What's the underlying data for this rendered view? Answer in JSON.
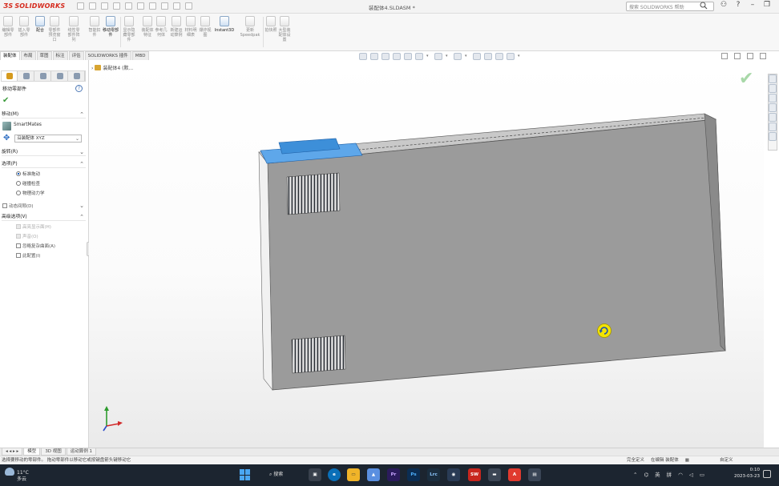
{
  "app": {
    "name": "SOLIDWORKS",
    "doc_title": "装配体4.SLDASM *"
  },
  "search": {
    "placeholder": "搜索 SOLIDWORKS 帮助"
  },
  "tabs": [
    "装配体",
    "布局",
    "草图",
    "标注",
    "评估",
    "SOLIDWORKS 插件",
    "MBD"
  ],
  "ribbon": {
    "items": [
      "编辑零部件",
      "插入零部件",
      "配合",
      "零部件预览窗口",
      "线性零部件阵列",
      "智能扣件",
      "移动零部件",
      "显示隐藏零部件",
      "装配体特征",
      "参考几何体",
      "新建运动算例",
      "材料明细表",
      "爆炸视图",
      "Instant3D",
      "更新Speedpak",
      "拍快照",
      "大型装配体设置"
    ],
    "active": "移动零部件"
  },
  "panel": {
    "title": "移动零部件",
    "move_section": "移动(M)",
    "smartmates": "SmartMates",
    "move_mode": "沿装配体 XYZ",
    "rotate_section": "旋转(R)",
    "options_section": "选项(P)",
    "options": [
      {
        "label": "标准拖动",
        "checked": true
      },
      {
        "label": "碰撞检查",
        "checked": false
      },
      {
        "label": "物理动力学",
        "checked": false
      }
    ],
    "dynamic_clearance": "动态间隙(D)",
    "advanced_section": "高级选项(V)",
    "advanced": [
      {
        "label": "高亮显示面(H)",
        "disabled": true
      },
      {
        "label": "声音(O)",
        "disabled": true
      },
      {
        "label": "忽略复杂曲面(A)",
        "disabled": false
      },
      {
        "label": "此配置(I)",
        "disabled": false
      }
    ]
  },
  "tree": {
    "root": "装配体4 (默..."
  },
  "bottom_tabs": [
    "模型",
    "3D 视图",
    "运动算例 1"
  ],
  "status": {
    "left": "选择要移动的零部件。",
    "hint": "拖动零部件以移动它或按键盘箭头键移动它",
    "right": [
      "完全定义",
      "在编辑 装配体",
      "自定义"
    ]
  },
  "taskbar": {
    "weather_temp": "11°C",
    "weather_desc": "多云",
    "search": "搜索",
    "apps": [
      {
        "label": "Pr",
        "color": "#2b1b5c"
      },
      {
        "label": "Ps",
        "color": "#0b2d52"
      },
      {
        "label": "Lrc",
        "color": "#1b2e3f"
      },
      {
        "label": "SW",
        "color": "#c8261e"
      },
      {
        "label": "A",
        "color": "#e03a2f"
      }
    ],
    "tray": [
      "英",
      "拼"
    ],
    "time": "0:10",
    "date": "2023-03-23"
  },
  "colors": {
    "accent": "#d52b1e",
    "part_body": "#9b9b9b",
    "part_handle": "#3d8fd9"
  }
}
